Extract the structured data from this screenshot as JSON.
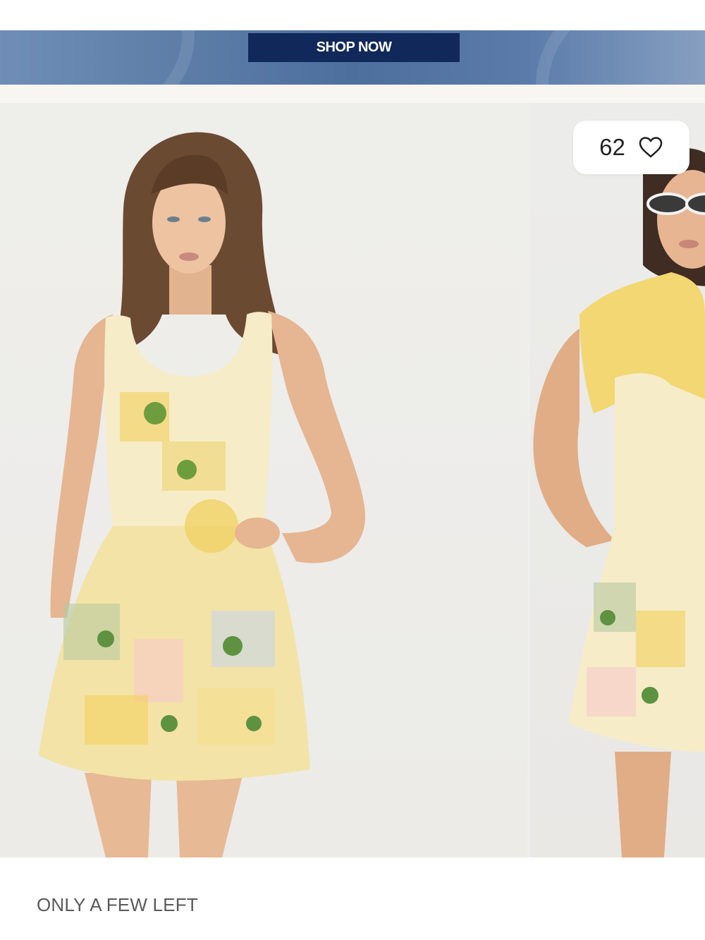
{
  "banner": {
    "cta_label": "SHOP NOW",
    "background": "#5b7aa8",
    "cta_color": "#10285a"
  },
  "carousel": {
    "slides": [
      {
        "image": "model-front-floral-mini-dress"
      },
      {
        "image": "model-sunglasses-yellow-sweater-floral-dress"
      }
    ],
    "like_count": "62",
    "like_icon": "heart-outline-icon"
  },
  "product": {
    "stock_status": "ONLY A FEW LEFT"
  }
}
